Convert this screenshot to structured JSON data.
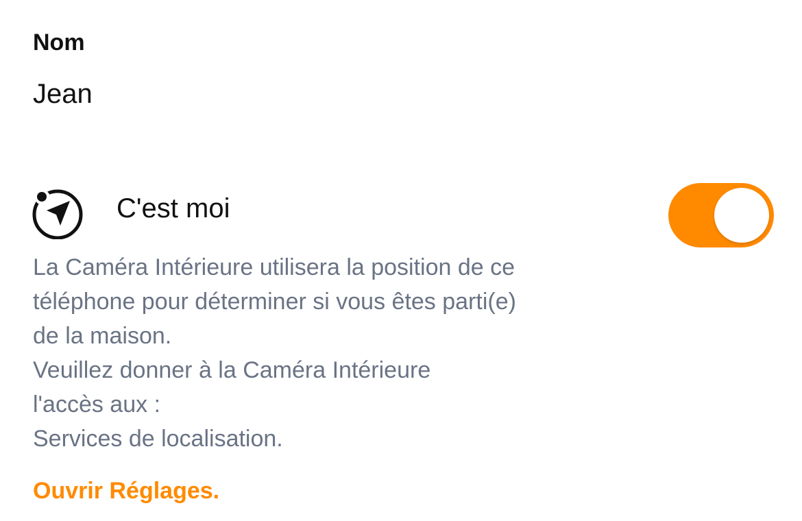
{
  "name_section": {
    "label": "Nom",
    "value": "Jean"
  },
  "location_toggle": {
    "label": "C'est moi",
    "icon": "location-arrow-icon",
    "enabled": true,
    "on_color": "#FF8A00"
  },
  "description_lines": [
    "La Caméra Intérieure utilisera la position de ce",
    "téléphone pour déterminer si vous êtes parti(e)",
    "de la maison.",
    "Veuillez donner à la Caméra Intérieure",
    "l'accès aux :",
    "Services de localisation."
  ],
  "settings_link": {
    "label": "Ouvrir Réglages.",
    "color": "#FF8A00"
  }
}
